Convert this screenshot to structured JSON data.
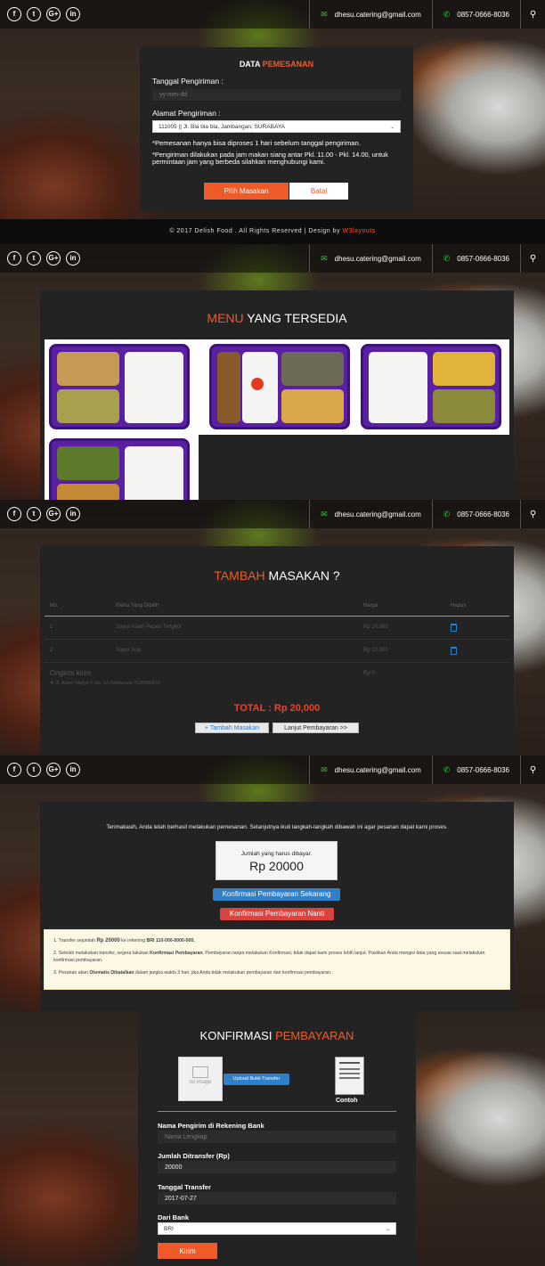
{
  "topbar": {
    "social": [
      "f",
      "t",
      "G+",
      "in"
    ],
    "email": "dhesu.catering@gmail.com",
    "phone": "0857-0666-8036",
    "icons": {
      "email": "envelope-icon",
      "phone": "phone-icon",
      "search": "search-icon"
    }
  },
  "order_form": {
    "title_white": "DATA",
    "title_orange": "PEMESANAN",
    "date_label": "Tanggal Pengiriman :",
    "date_placeholder": "yy-mm-dd",
    "address_label": "Alamat Pengiriman :",
    "address_value": "111005 || Jl. Bla bla bla, Jambangan, SURABAYA",
    "note1": "*Pemesanan hanya bisa diproses 1 hari sebelum tanggal pengiriman.",
    "note2": "*Pengiriman dilakukan pada jam makan siang antar Pkl. 11.00 - Pkl. 14.00, untuk permintaan jam yang berbeda silahkan menghubungi kami.",
    "choose_button": "Pilih Masakan",
    "cancel_button": "Batal"
  },
  "footer": {
    "text": "© 2017 Delish Food . All Rights Reserved | Design by",
    "link": "W3layouts"
  },
  "menu": {
    "title_orange": "MENU",
    "title_white": "YANG TERSEDIA"
  },
  "cart": {
    "title_orange": "TAMBAH",
    "title_white": "MASAKAN ?",
    "headers": [
      "No.",
      "Menu Yang Dipilih",
      "Harga",
      "Hapus"
    ],
    "rows": [
      {
        "no": "1",
        "menu": "Sayur Asam Pepes Tongkol",
        "price": "Rp 10,000"
      },
      {
        "no": "2",
        "menu": "Sayur Sop",
        "price": "Rp 10,000"
      }
    ],
    "shipping_label": "Ongkos kirim",
    "shipping_address": "Jl. Asem Mulya V No. 54 Asemrowo SURABAYA",
    "shipping_price": "Rp 0",
    "total": "TOTAL : Rp 20,000",
    "add_button": "+ Tambah Masakan",
    "continue_button": "Lanjut Pembayaran >>"
  },
  "thanks": {
    "message": "Terimakasih, Anda telah berhasil melakukan pemesanan. Selanjutnya ikuti langkah-langkah dibawah ini agar pesanan dapat kami proses.",
    "amount_label": "Jumlah yang harus dibayar.",
    "amount": "Rp 20000",
    "confirm_now": "Konfirmasi Pembayaran Sekarang",
    "confirm_later": "Konfirmasi Pembayaran Nanti",
    "step1_pre": "1. Transfer sejumlah",
    "step1_amount": "Rp 20000",
    "step1_mid": "ke rekening",
    "step1_account": "BRI 110-000-0000-000.",
    "step2_pre": "2. Setelah melakukan transfer, segera lakukan",
    "step2_bold": "Konfirmasi Pembayaran",
    "step2_post": ". Pembayaran tanpa melakukan Konfirmasi, tidak dapat kami proses lebih lanjut. Pastikan Anda mengisi data yang sesuai saat melakukan konfirmasi pembayaran.",
    "step3_pre": "3. Pesanan akan",
    "step3_bold": "Otomatis Dibatalkan",
    "step3_post": "dalam jangka waktu 3 hari, jika Anda tidak melakukan pembayaran dan konfirmasi pembayaran."
  },
  "payment": {
    "title_white": "KONFIRMASI",
    "title_orange": "PEMBAYARAN",
    "no_image": "no image",
    "upload_button": "Upload Bukti Transfer",
    "example_label": "Contoh",
    "sender_label": "Nama Pengirim di Rekening Bank",
    "sender_placeholder": "Nama Lengkap",
    "amount_label": "Jumlah Ditransfer (Rp)",
    "amount_value": "20000",
    "date_label": "Tanggal Transfer",
    "date_value": "2017-07-27",
    "bank_label": "Dari Bank",
    "bank_value": "BRI",
    "submit_button": "Kirim"
  },
  "colors": {
    "accent": "#f05a28",
    "panel": "#232323",
    "blue_button": "#2f80c9",
    "red_button": "#d9443f"
  }
}
